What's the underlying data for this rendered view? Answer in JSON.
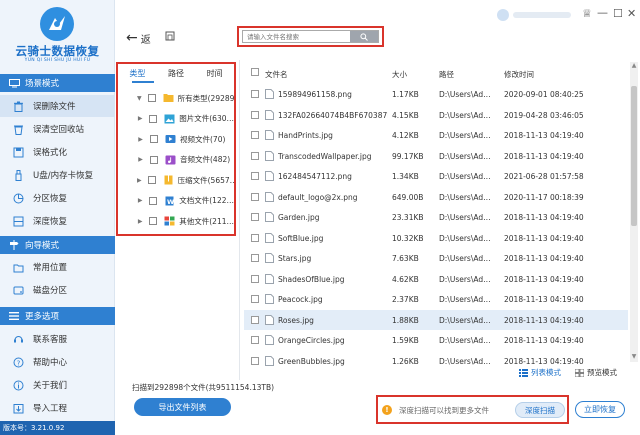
{
  "app": {
    "logo_title": "云骑士数据恢复",
    "logo_subtitle": "YUN QI SHI SHU JU HUI FU",
    "version_label": "版本号：3.21.0.92"
  },
  "sidebar": {
    "scene_mode": {
      "title": "场景模式",
      "items": [
        {
          "label": "误删除文件",
          "icon": "trash-icon",
          "active": true
        },
        {
          "label": "误清空回收站",
          "icon": "recycle-bin-icon"
        },
        {
          "label": "误格式化",
          "icon": "format-disk-icon"
        },
        {
          "label": "U盘/内存卡恢复",
          "icon": "usb-drive-icon"
        },
        {
          "label": "分区恢复",
          "icon": "partition-icon"
        },
        {
          "label": "深度恢复",
          "icon": "deep-scan-icon"
        }
      ]
    },
    "wizard_mode": {
      "title": "向导模式",
      "items": [
        {
          "label": "常用位置",
          "icon": "common-location-icon"
        },
        {
          "label": "磁盘分区",
          "icon": "disk-partition-icon"
        }
      ]
    },
    "more_options": {
      "title": "更多选项",
      "items": [
        {
          "label": "联系客服",
          "icon": "support-icon"
        },
        {
          "label": "帮助中心",
          "icon": "help-icon"
        },
        {
          "label": "关于我们",
          "icon": "info-icon"
        },
        {
          "label": "导入工程",
          "icon": "import-icon"
        }
      ]
    }
  },
  "topbar": {
    "back_label": "返",
    "search_placeholder": "请输入文件名搜索"
  },
  "tree": {
    "tabs": [
      "类型",
      "路径",
      "时间"
    ],
    "active_tab": 0,
    "rows": [
      {
        "label": "所有类型(29289…",
        "icon": "folder-icon",
        "color": "#f5b82e",
        "expandable": false
      },
      {
        "label": "图片文件(630…",
        "icon": "image-file-icon",
        "color": "#2fa3d6",
        "expandable": true
      },
      {
        "label": "视频文件(70)",
        "icon": "video-file-icon",
        "color": "#2f80d1",
        "expandable": true
      },
      {
        "label": "音频文件(482)",
        "icon": "audio-file-icon",
        "color": "#9b4fc9",
        "expandable": true
      },
      {
        "label": "压缩文件(5657…",
        "icon": "archive-file-icon",
        "color": "#f5b82e",
        "expandable": true
      },
      {
        "label": "文档文件(122…",
        "icon": "document-file-icon",
        "color": "#2f80d1",
        "expandable": true
      },
      {
        "label": "其他文件(211…",
        "icon": "other-file-icon",
        "color": "#e8453c",
        "expandable": true
      }
    ]
  },
  "file_table": {
    "columns": [
      "文件名",
      "大小",
      "路径",
      "修改时间"
    ],
    "rows": [
      {
        "name": "159894961158.png",
        "size": "1.17KB",
        "path": "D:\\Users\\Ad…",
        "mtime": "2020-09-01 08:40:25"
      },
      {
        "name": "132FA02664074B4BF670387D…",
        "size": "4.15KB",
        "path": "D:\\Users\\Ad…",
        "mtime": "2019-04-28 03:46:05"
      },
      {
        "name": "HandPrints.jpg",
        "size": "4.12KB",
        "path": "D:\\Users\\Ad…",
        "mtime": "2018-11-13 04:19:40"
      },
      {
        "name": "TranscodedWallpaper.jpg",
        "size": "99.17KB",
        "path": "D:\\Users\\Ad…",
        "mtime": "2018-11-13 04:19:40"
      },
      {
        "name": "162484547112.png",
        "size": "1.34KB",
        "path": "D:\\Users\\Ad…",
        "mtime": "2021-06-28 01:57:58"
      },
      {
        "name": "default_logo@2x.png",
        "size": "649.00B",
        "path": "D:\\Users\\Ad…",
        "mtime": "2020-11-17 00:18:39"
      },
      {
        "name": "Garden.jpg",
        "size": "23.31KB",
        "path": "D:\\Users\\Ad…",
        "mtime": "2018-11-13 04:19:40"
      },
      {
        "name": "SoftBlue.jpg",
        "size": "10.32KB",
        "path": "D:\\Users\\Ad…",
        "mtime": "2018-11-13 04:19:40"
      },
      {
        "name": "Stars.jpg",
        "size": "7.63KB",
        "path": "D:\\Users\\Ad…",
        "mtime": "2018-11-13 04:19:40"
      },
      {
        "name": "ShadesOfBlue.jpg",
        "size": "4.62KB",
        "path": "D:\\Users\\Ad…",
        "mtime": "2018-11-13 04:19:40"
      },
      {
        "name": "Peacock.jpg",
        "size": "2.37KB",
        "path": "D:\\Users\\Ad…",
        "mtime": "2018-11-13 04:19:40"
      },
      {
        "name": "Roses.jpg",
        "size": "1.88KB",
        "path": "D:\\Users\\Ad…",
        "mtime": "2018-11-13 04:19:40",
        "selected": true
      },
      {
        "name": "OrangeCircles.jpg",
        "size": "1.59KB",
        "path": "D:\\Users\\Ad…",
        "mtime": "2018-11-13 04:19:40"
      },
      {
        "name": "GreenBubbles.jpg",
        "size": "1.26KB",
        "path": "D:\\Users\\Ad…",
        "mtime": "2018-11-13 04:19:40"
      }
    ]
  },
  "view": {
    "list_mode_label": "列表模式",
    "preview_mode_label": "预览模式"
  },
  "footer": {
    "scan_stat": "扫描到292898个文件(共9511154.13TB)",
    "export_label": "导出文件列表",
    "hint_text": "深度扫描可以找到更多文件",
    "deep_scan_label": "深度扫描",
    "recover_label": "立即恢复"
  },
  "colors": {
    "accent": "#2f80d1",
    "highlight_border": "#d9342b",
    "warning": "#f3a21c"
  }
}
